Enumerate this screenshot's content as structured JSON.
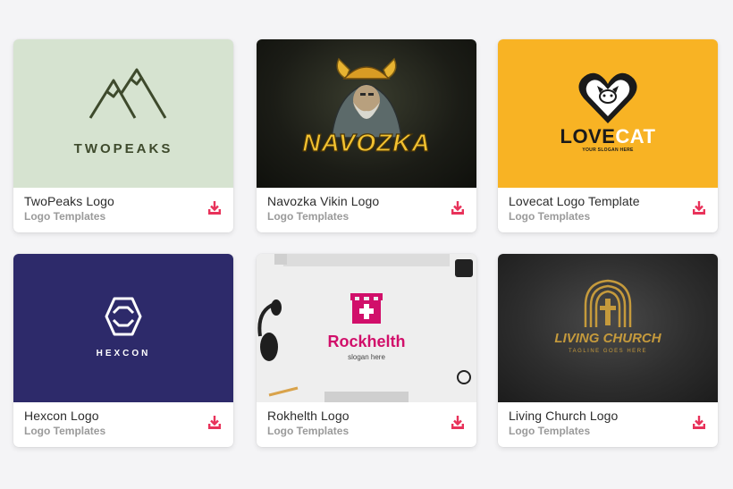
{
  "cards": [
    {
      "title": "TwoPeaks Logo",
      "category": "Logo Templates",
      "thumb_text": "TWOPEAKS",
      "icon": "download-icon"
    },
    {
      "title": "Navozka Vikin Logo",
      "category": "Logo Templates",
      "thumb_text": "NAVOZKA",
      "icon": "download-icon"
    },
    {
      "title": "Lovecat Logo Template",
      "category": "Logo Templates",
      "thumb_text_a": "LOVE",
      "thumb_text_b": "CAT",
      "thumb_tagline": "YOUR SLOGAN HERE",
      "icon": "download-icon"
    },
    {
      "title": "Hexcon Logo",
      "category": "Logo Templates",
      "thumb_text": "HEXCON",
      "icon": "download-icon"
    },
    {
      "title": "Rokhelth Logo",
      "category": "Logo Templates",
      "thumb_text": "Rockhelth",
      "thumb_tagline": "slogan here",
      "icon": "download-icon"
    },
    {
      "title": "Living Church Logo",
      "category": "Logo Templates",
      "thumb_text": "LIVING CHURCH",
      "thumb_tagline": "TAGLINE GOES HERE",
      "icon": "download-icon"
    }
  ],
  "colors": {
    "accent": "#e8325a",
    "title": "#2c2c2c",
    "subtitle": "#9a9a9a",
    "page_bg": "#f4f4f6"
  }
}
